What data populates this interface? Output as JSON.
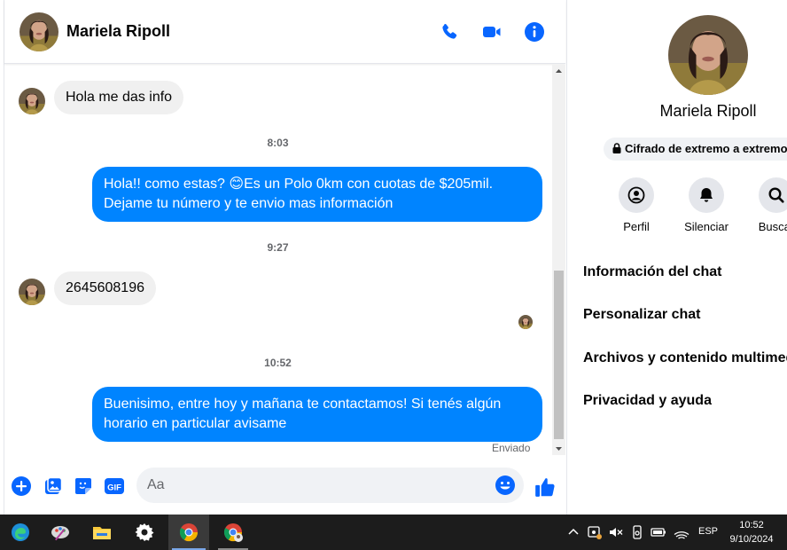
{
  "contact": {
    "name": "Mariela Ripoll"
  },
  "header": {
    "icons": [
      "phone-icon",
      "video-camera-icon",
      "info-icon"
    ]
  },
  "messages": {
    "m1": "Hola me das info",
    "t1": "8:03",
    "m2_line1": "Hola!! como estas? 😊Es un Polo 0km con cuotas de $205mil.",
    "m2_line2": "Dejame tu número y te envio mas información",
    "t2": "9:27",
    "m3": "2645608196",
    "t3": "10:52",
    "m4_line1": "Buenisimo, entre hoy y mañana te contactamos! Si tenés algún",
    "m4_line2": "horario en particular avisame",
    "status": "Enviado"
  },
  "composer": {
    "placeholder": "Aa",
    "icons": [
      "add-icon",
      "photo-icon",
      "sticker-icon",
      "gif-icon",
      "emoji-icon",
      "like-icon"
    ],
    "gif_label": "GIF"
  },
  "info_pane": {
    "encryption": "Cifrado de extremo a extremo",
    "actions": [
      {
        "label": "Perfil",
        "icon": "profile-icon"
      },
      {
        "label": "Silenciar",
        "icon": "bell-icon"
      },
      {
        "label": "Buscar",
        "icon": "search-icon"
      }
    ],
    "menu": [
      "Información del chat",
      "Personalizar chat",
      "Archivos y contenido multimedia",
      "Privacidad y ayuda"
    ]
  },
  "taskbar": {
    "apps": [
      "edge-icon",
      "paint-icon",
      "file-explorer-icon",
      "settings-icon",
      "chrome-icon",
      "chrome-profile-icon"
    ],
    "language": "ESP",
    "time": "10:52",
    "date": "9/10/2024"
  },
  "colors": {
    "accent": "#0084ff",
    "icon_blue": "#0866ff",
    "bubble_in": "#f0f0f0",
    "taskbar": "#1c1c1c"
  }
}
